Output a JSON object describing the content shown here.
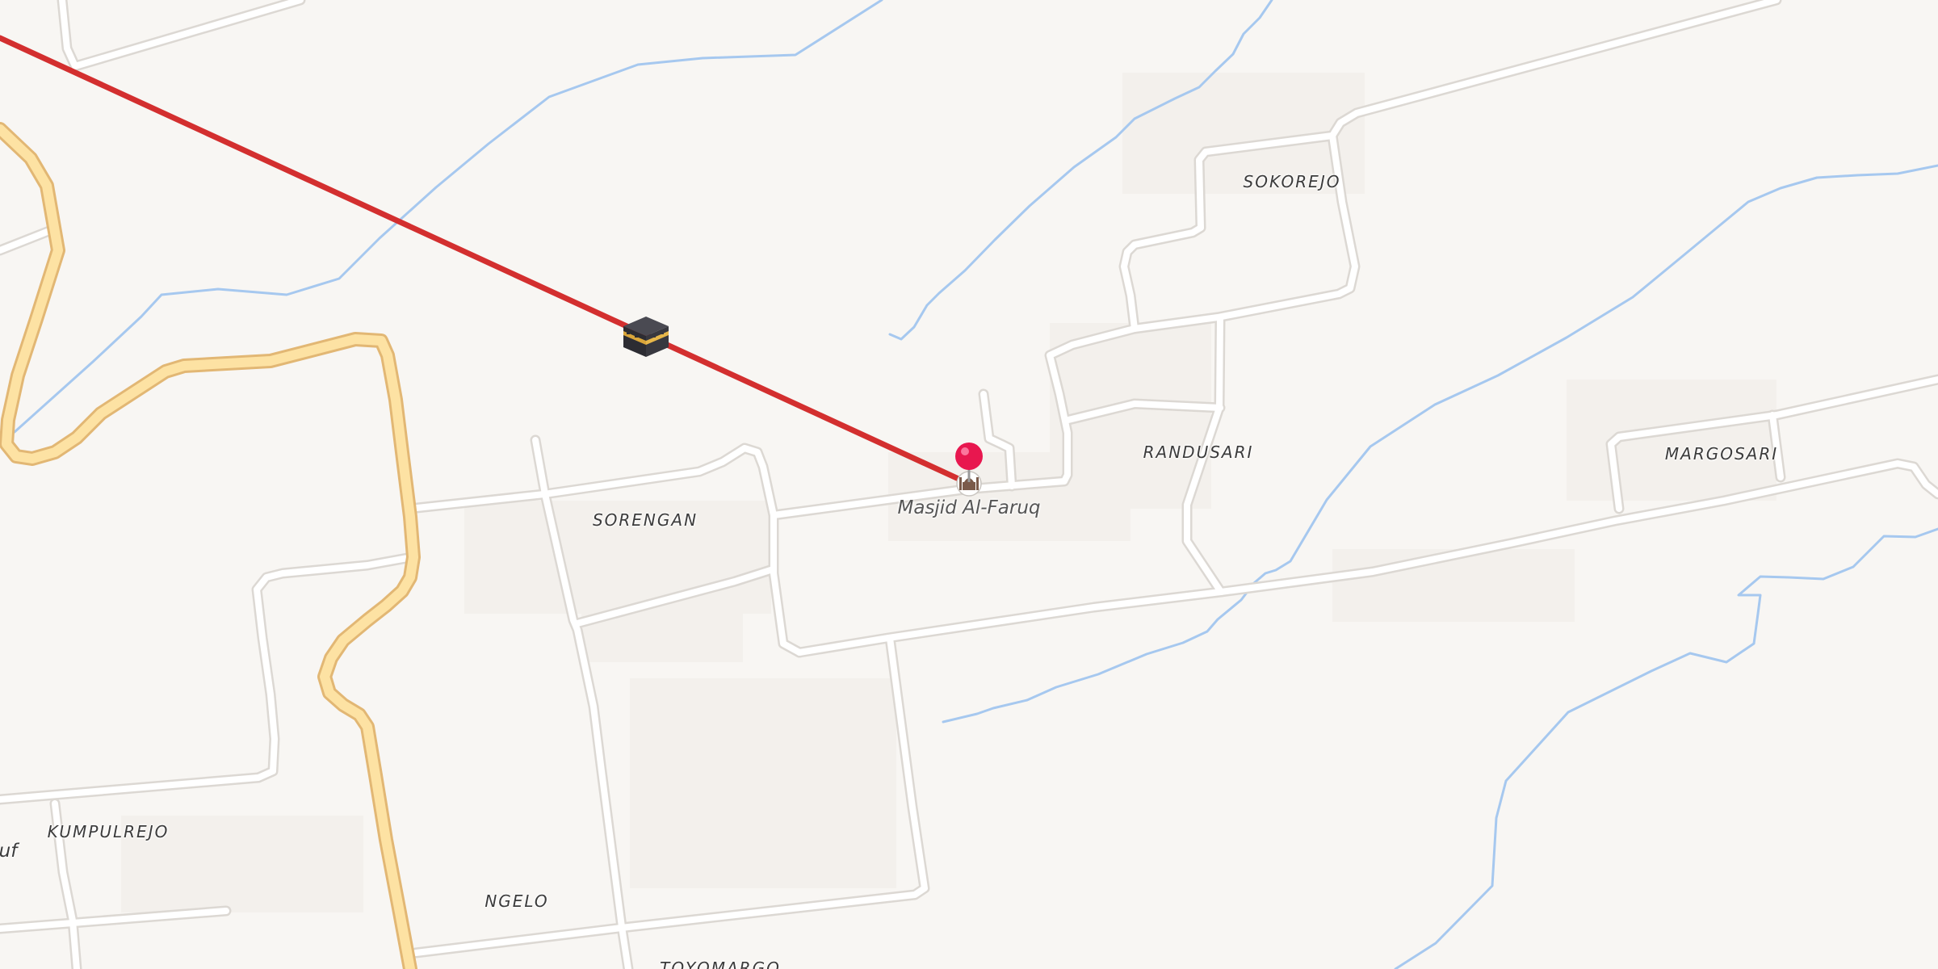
{
  "map": {
    "colors": {
      "background": "#f8f6f3",
      "road": "#ffffff",
      "road_casing": "#dcd8d3",
      "main_road": "#fde2a3",
      "main_road_casing": "#e2b774",
      "river": "#a6c8ef",
      "qibla_line": "#d32f2f",
      "pin": "#e8174f"
    },
    "places": [
      {
        "id": "sokorejo",
        "label": "SOKOREJO"
      },
      {
        "id": "randusari",
        "label": "RANDUSARI"
      },
      {
        "id": "margosari",
        "label": "MARGOSARI"
      },
      {
        "id": "sorengan",
        "label": "SORENGAN"
      },
      {
        "id": "kumpulrejo",
        "label": "KUMPULREJO"
      },
      {
        "id": "ngelo",
        "label": "NGELO"
      },
      {
        "id": "toyomargo",
        "label": "TOYOMARGO"
      },
      {
        "id": "partial",
        "label": "uf"
      }
    ],
    "poi": {
      "name": "Masjid Al-Faruq",
      "icon": "mosque-icon"
    },
    "qibla": {
      "icon": "kaaba-icon",
      "line": "qibla-direction-line"
    },
    "pin": {
      "icon": "location-pin-icon"
    }
  }
}
